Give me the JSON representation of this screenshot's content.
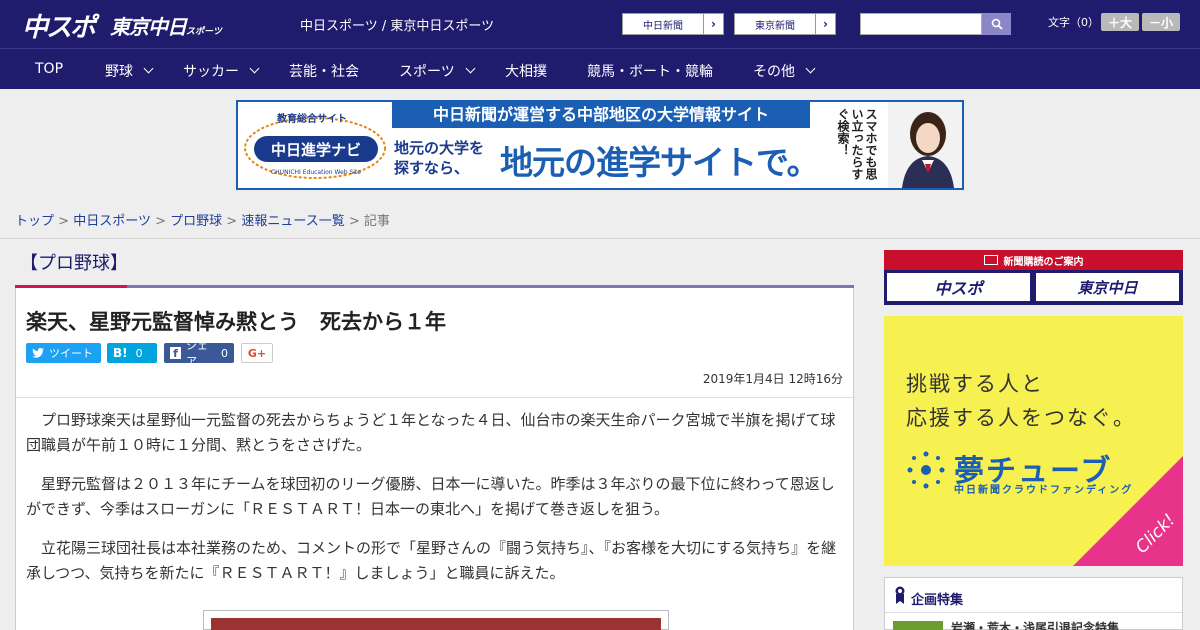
{
  "header": {
    "logo_main": "中スポ",
    "logo_tokyo": "東京中日",
    "logo_tokyo_small": "スポーツ",
    "site_names": "中日スポーツ / 東京中日スポーツ",
    "paper_buttons": [
      "中日新聞",
      "東京新聞"
    ],
    "search_placeholder": "",
    "font_label": "文字（0）",
    "font_bigger": "＋大",
    "font_smaller": "－小"
  },
  "nav": {
    "items": [
      {
        "label": "TOP",
        "has_menu": false
      },
      {
        "label": "野球",
        "has_menu": true
      },
      {
        "label": "サッカー",
        "has_menu": true
      },
      {
        "label": "芸能・社会",
        "has_menu": false
      },
      {
        "label": "スポーツ",
        "has_menu": true
      },
      {
        "label": "大相撲",
        "has_menu": false
      },
      {
        "label": "競馬・ボート・競輪",
        "has_menu": false
      },
      {
        "label": "その他",
        "has_menu": true
      }
    ]
  },
  "banner": {
    "logo_top": "教育総合サイト",
    "logo_main": "中日進学ナビ",
    "logo_en": "CHUNICHI Education Web Site",
    "headline": "中日新聞が運営する中部地区の大学情報サイト",
    "sub_line1": "地元の大学を",
    "sub_line2": "探すなら、",
    "main": "地元の進学サイトで。",
    "vertical": "スマホでも思い立ったらすぐ検索！"
  },
  "breadcrumb": {
    "links": [
      "トップ",
      "中日スポーツ",
      "プロ野球",
      "速報ニュース一覧"
    ],
    "separator": ">",
    "current": "記事"
  },
  "article": {
    "category": "【プロ野球】",
    "title": "楽天、星野元監督悼み黙とう　死去から１年",
    "share": {
      "tweet": "ツイート",
      "hatena": "B!",
      "hatena_count": "0",
      "facebook": "シェア",
      "facebook_count": "0",
      "gplus": "G+"
    },
    "date": "2019年1月4日 12時16分",
    "paragraphs": [
      "プロ野球楽天は星野仙一元監督の死去からちょうど１年となった４日、仙台市の楽天生命パーク宮城で半旗を掲げて球団職員が午前１０時に１分間、黙とうをささげた。",
      "星野元監督は２０１３年にチームを球団初のリーグ優勝、日本一に導いた。昨季は３年ぶりの最下位に終わって恩返しができず、今季はスローガンに「ＲＥＳＴＡＲＴ！日本一の東北へ」を掲げて巻き返しを狙う。",
      "立花陽三球団社長は本社業務のため、コメントの形で「星野さんの『闘う気持ち』、『お客様を大切にする気持ち』を継承しつつ、気持ちを新たに『ＲＥＳＴＡＲＴ！』しましょう」と職員に訴えた。"
    ]
  },
  "sidebar": {
    "subscribe_head": "新聞購読のご案内",
    "subscribe_buttons": [
      "中スポ",
      "東京中日"
    ],
    "ad_line1": "挑戦する人と",
    "ad_line2": "応援する人をつなぐ。",
    "ad_logo": "夢チューブ",
    "ad_sub": "中日新聞クラウドファンディング",
    "ad_click": "Click!",
    "special_head": "企画特集",
    "special_item": "岩瀬・荒木・浅尾引退記念特集"
  },
  "colors": {
    "header_bg": "#1f1c6e",
    "accent_red": "#d3154c",
    "accent_purple": "#7e74b6",
    "twitter": "#1da1f2",
    "hatena": "#00a4de",
    "facebook": "#3b5998"
  }
}
